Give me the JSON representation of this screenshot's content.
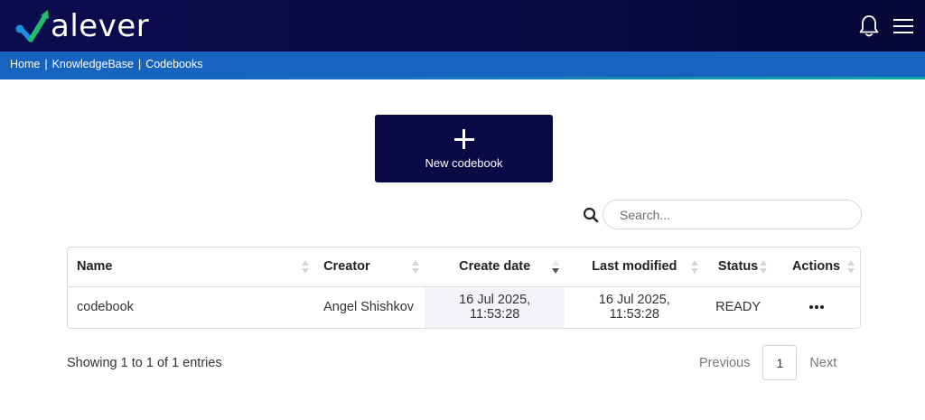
{
  "header": {
    "logo_text": "alever",
    "icons": [
      "bell-icon",
      "hamburger-menu-icon"
    ],
    "colors": {
      "topbar": "#080a46",
      "crumbbar": "#1664bf",
      "accent_green": "#1fbf6a",
      "accent_blue": "#1b8fe0"
    }
  },
  "breadcrumb": {
    "items": [
      "Home",
      "KnowledgeBase",
      "Codebooks"
    ],
    "separator": "|"
  },
  "new_button": {
    "label": "New codebook",
    "icon": "plus-icon"
  },
  "search": {
    "placeholder": "Search...",
    "value": "",
    "icon": "search-icon"
  },
  "table": {
    "columns": [
      "Name",
      "Creator",
      "Create date",
      "Last modified",
      "Status",
      "Actions"
    ],
    "sorted_column": "Create date",
    "sort_direction": "desc",
    "rows": [
      {
        "name": "codebook",
        "creator": "Angel Shishkov",
        "create_date": "16 Jul 2025, 11:53:28",
        "last_modified": "16 Jul 2025, 11:53:28",
        "status": "READY",
        "actions_icon": "more-horizontal-icon"
      }
    ]
  },
  "footer": {
    "info": "Showing 1 to 1 of 1 entries",
    "previous": "Previous",
    "page": "1",
    "next": "Next"
  }
}
